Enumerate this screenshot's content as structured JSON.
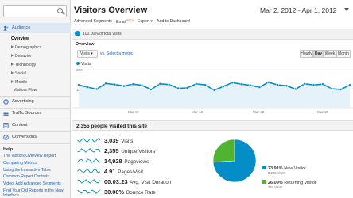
{
  "sidebar": {
    "sections": [
      {
        "label": "Audience",
        "icon": "users-icon"
      },
      {
        "label": "Advertising",
        "icon": "advertising-icon"
      },
      {
        "label": "Traffic Sources",
        "icon": "traffic-icon"
      },
      {
        "label": "Content",
        "icon": "content-icon"
      },
      {
        "label": "Conversions",
        "icon": "conversions-icon"
      }
    ],
    "audience_items": [
      "Overview",
      "Demographics",
      "Behavior",
      "Technology",
      "Social",
      "Mobile",
      "Visitors Flow"
    ],
    "help": {
      "title": "Help",
      "links": [
        "The Visitors Overview Report",
        "Comparing Metrics",
        "Using the Interactive Table",
        "Common Report Controls",
        "Video: Add Advanced Segments",
        "Find Your Old Reports in the New Interface"
      ]
    }
  },
  "header": {
    "title": "Visitors Overview",
    "date_range": "Mar 2, 2012 - Apr 1, 2012"
  },
  "toolbar": {
    "advanced_segments": "Advanced Segments",
    "email": "Email",
    "beta": "BETA",
    "export": "Export",
    "add_dashboard": "Add to Dashboard"
  },
  "segment": {
    "label": "100.00% of total visits"
  },
  "tab": "Overview",
  "controls": {
    "metric": "Visits",
    "vs": "vs.",
    "select_metric": "Select a metric",
    "ranges": [
      "Hourly",
      "Day",
      "Week",
      "Month"
    ],
    "selected_range": "Day"
  },
  "chart_data": {
    "type": "line",
    "series": [
      {
        "name": "Visits",
        "values": [
          120,
          108,
          98,
          128,
          122,
          114,
          124,
          118,
          96,
          126,
          122,
          102,
          104,
          126,
          120,
          92,
          112,
          132,
          124,
          118,
          108,
          134,
          120,
          116,
          98,
          126,
          120,
          124,
          100,
          96,
          120
        ]
      }
    ],
    "x_ticks": [
      "Mar 8",
      "Mar 15",
      "Mar 22",
      "Mar 29"
    ],
    "y_ticks": [
      "200",
      "100"
    ],
    "ylim": [
      0,
      200
    ]
  },
  "summary_title": "2,355 people visited this site",
  "metrics": [
    {
      "value": "3,039",
      "name": "Visits"
    },
    {
      "value": "2,355",
      "name": "Unique Visitors"
    },
    {
      "value": "14,928",
      "name": "Pageviews"
    },
    {
      "value": "4.91",
      "name": "Pages/Visit"
    },
    {
      "value": "00:03:23",
      "name": "Avg. Visit Duration"
    },
    {
      "value": "30.00%",
      "name": "Bounce Rate"
    }
  ],
  "pie": {
    "slices": [
      {
        "pct": "73.91%",
        "label": "New Visitor",
        "count": "2,246 Visits",
        "value": 73.91,
        "color": "#058dc7"
      },
      {
        "pct": "26.09%",
        "label": "Returning Visitor",
        "count": "793 Visits",
        "value": 26.09,
        "color": "#50b432"
      }
    ]
  },
  "colors": {
    "accent": "#058dc7",
    "link": "#1a63b0",
    "returning": "#50b432"
  }
}
